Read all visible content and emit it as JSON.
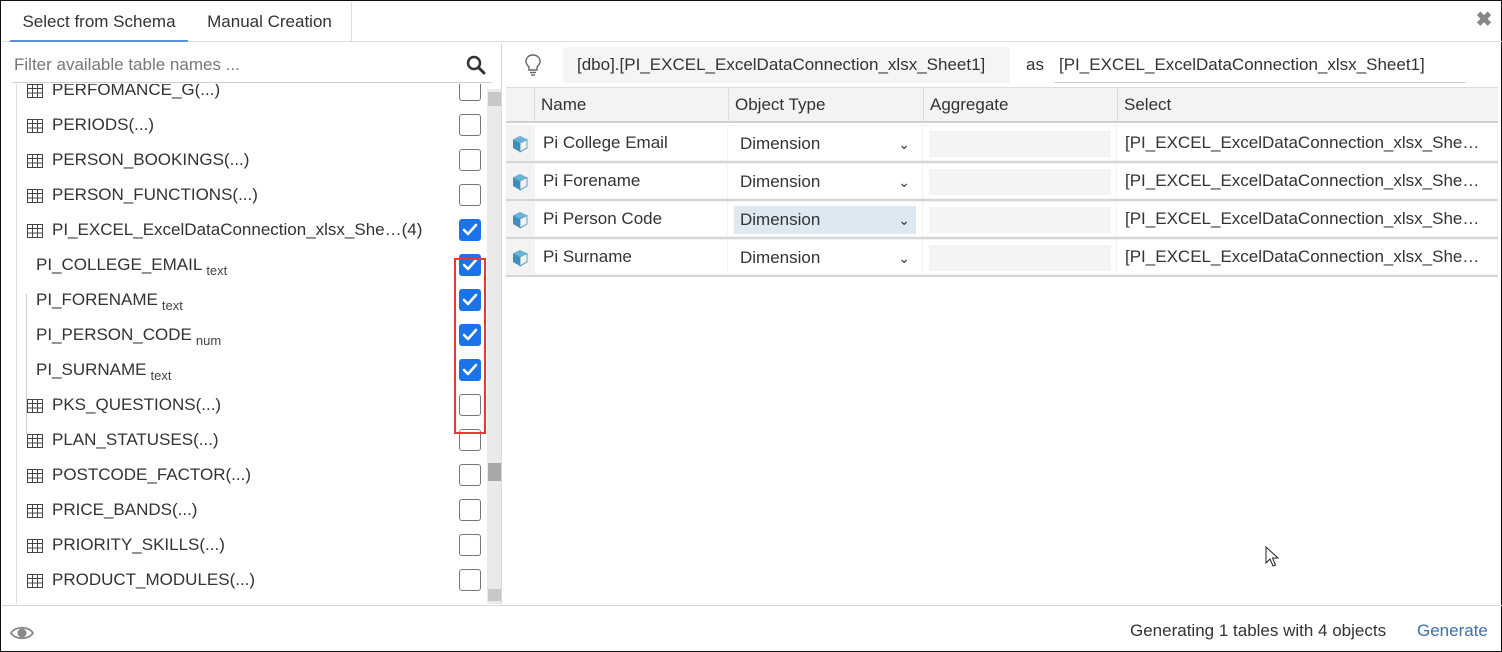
{
  "tabs": [
    {
      "label": "Select from Schema",
      "active": true
    },
    {
      "label": "Manual Creation",
      "active": false
    }
  ],
  "close_icon": "close-icon",
  "filter": {
    "placeholder": "Filter available table names ...",
    "value": "",
    "icon": "search-icon"
  },
  "table_list": {
    "items": [
      {
        "label": "PERFOMANCE_G(...)",
        "type": "table",
        "checked": false,
        "partial": true
      },
      {
        "label": "PERIODS(...)",
        "type": "table",
        "checked": false
      },
      {
        "label": "PERSON_BOOKINGS(...)",
        "type": "table",
        "checked": false
      },
      {
        "label": "PERSON_FUNCTIONS(...)",
        "type": "table",
        "checked": false
      },
      {
        "label": "PI_EXCEL_ExcelDataConnection_xlsx_She…(4)",
        "type": "table",
        "checked": true
      },
      {
        "label": "PI_COLLEGE_EMAIL",
        "datatype": "text",
        "type": "column",
        "checked": true
      },
      {
        "label": "PI_FORENAME",
        "datatype": "text",
        "type": "column",
        "checked": true
      },
      {
        "label": "PI_PERSON_CODE",
        "datatype": "num",
        "type": "column",
        "checked": true
      },
      {
        "label": "PI_SURNAME",
        "datatype": "text",
        "type": "column",
        "checked": true
      },
      {
        "label": "PKS_QUESTIONS(...)",
        "type": "table",
        "checked": false
      },
      {
        "label": "PLAN_STATUSES(...)",
        "type": "table",
        "checked": false
      },
      {
        "label": "POSTCODE_FACTOR(...)",
        "type": "table",
        "checked": false
      },
      {
        "label": "PRICE_BANDS(...)",
        "type": "table",
        "checked": false
      },
      {
        "label": "PRIORITY_SKILLS(...)",
        "type": "table",
        "checked": false
      },
      {
        "label": "PRODUCT_MODULES(...)",
        "type": "table",
        "checked": false
      }
    ]
  },
  "source": {
    "name": "[dbo].[PI_EXCEL_ExcelDataConnection_xlsx_Sheet1]",
    "as_label": "as",
    "alias": "[PI_EXCEL_ExcelDataConnection_xlsx_Sheet1]"
  },
  "grid": {
    "columns": [
      "Name",
      "Object Type",
      "Aggregate",
      "Select"
    ],
    "rows": [
      {
        "name": "Pi College Email",
        "object_type": "Dimension",
        "aggregate": "",
        "select": "[PI_EXCEL_ExcelDataConnection_xlsx_She…",
        "focused": false
      },
      {
        "name": "Pi Forename",
        "object_type": "Dimension",
        "aggregate": "",
        "select": "[PI_EXCEL_ExcelDataConnection_xlsx_She…",
        "focused": false
      },
      {
        "name": "Pi Person Code",
        "object_type": "Dimension",
        "aggregate": "",
        "select": "[PI_EXCEL_ExcelDataConnection_xlsx_She…",
        "focused": true
      },
      {
        "name": "Pi Surname",
        "object_type": "Dimension",
        "aggregate": "",
        "select": "[PI_EXCEL_ExcelDataConnection_xlsx_She…",
        "focused": false
      }
    ]
  },
  "footer": {
    "status": "Generating 1 tables with 4 objects",
    "generate_label": "Generate"
  },
  "colors": {
    "accent": "#1a73e8",
    "highlight_border": "#e53935",
    "link": "#3d6fa8",
    "tab_underline": "#5b8fd6"
  }
}
